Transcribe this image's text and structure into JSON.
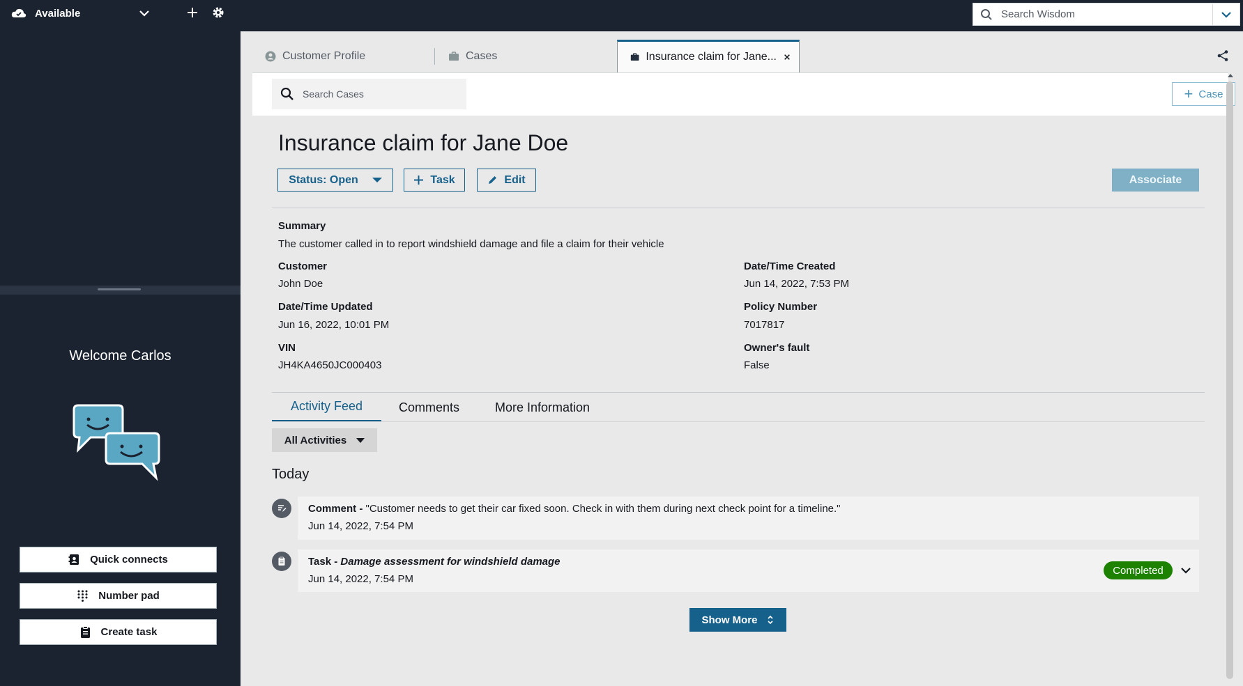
{
  "topbar": {
    "status_label": "Available",
    "wisdom_placeholder": "Search Wisdom",
    "icons": [
      "cloud-status-icon",
      "chevron-down-icon",
      "plus-icon",
      "gear-icon",
      "search-icon"
    ]
  },
  "sidebar": {
    "welcome": "Welcome Carlos",
    "buttons": [
      {
        "label": "Quick connects",
        "icon": "contacts-icon"
      },
      {
        "label": "Number pad",
        "icon": "dialpad-icon"
      },
      {
        "label": "Create task",
        "icon": "clipboard-icon"
      }
    ]
  },
  "tabs": [
    {
      "label": "Customer Profile",
      "icon": "user-icon"
    },
    {
      "label": "Cases",
      "icon": "briefcase-icon"
    },
    {
      "label": "Insurance claim for Jane...",
      "icon": "briefcase-icon",
      "active": true
    }
  ],
  "toolbar": {
    "search_placeholder": "Search Cases",
    "new_case_label": "Case"
  },
  "case": {
    "title": "Insurance claim for Jane Doe",
    "status_label": "Status: Open",
    "task_label": "Task",
    "edit_label": "Edit",
    "associate_label": "Associate",
    "summary_label": "Summary",
    "summary": "The customer called in to report windshield damage and file a claim for their vehicle",
    "fields": {
      "customer_label": "Customer",
      "customer": "John Doe",
      "created_label": "Date/Time Created",
      "created": "Jun 14, 2022, 7:53 PM",
      "updated_label": "Date/Time Updated",
      "updated": "Jun 16, 2022, 10:01 PM",
      "policy_label": "Policy Number",
      "policy": "7017817",
      "vin_label": "VIN",
      "vin": "JH4KA4650JC000403",
      "fault_label": "Owner's fault",
      "fault": "False"
    }
  },
  "subtabs": [
    "Activity Feed",
    "Comments",
    "More Information"
  ],
  "feed": {
    "filter_label": "All Activities",
    "group_label": "Today",
    "items": [
      {
        "type": "Comment -",
        "text": " \"Customer needs to get their car fixed soon. Check in with them during next check point for a timeline.\"",
        "time": "Jun 14, 2022, 7:54 PM"
      },
      {
        "type": "Task -",
        "text": " Damage assessment for windshield damage",
        "time": "Jun 14, 2022, 7:54 PM",
        "status": "Completed"
      }
    ],
    "show_more_label": "Show More"
  },
  "colors": {
    "dark_bg": "#1b2330",
    "accent": "#16618c",
    "completed": "#1d8102"
  }
}
